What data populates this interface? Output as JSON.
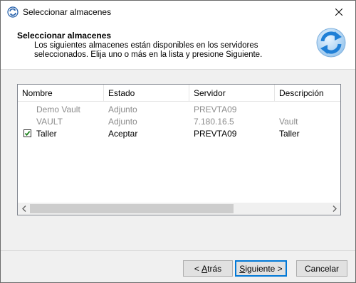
{
  "window": {
    "title": "Seleccionar almacenes",
    "title_icon": "sync-icon"
  },
  "header": {
    "title": "Seleccionar almacenes",
    "description": "Los siguientes almacenes están disponibles en los servidores seleccionados. Elija uno o más en la lista y presione Siguiente.",
    "icon": "sync-arrows-icon"
  },
  "list": {
    "columns": [
      "Nombre",
      "Estado",
      "Servidor",
      "Descripción"
    ],
    "rows": [
      {
        "name": "Demo Vault",
        "state": "Adjunto",
        "server": "PREVTA09",
        "description": "",
        "checked": false,
        "enabled": false
      },
      {
        "name": "VAULT",
        "state": "Adjunto",
        "server": "7.180.16.5",
        "description": "Vault",
        "checked": false,
        "enabled": false
      },
      {
        "name": "Taller",
        "state": "Aceptar",
        "server": "PREVTA09",
        "description": "Taller",
        "checked": true,
        "enabled": true
      }
    ]
  },
  "buttons": {
    "back_prefix": "< ",
    "back_access": "A",
    "back_rest": "trás",
    "next_access": "S",
    "next_rest": "iguiente >",
    "cancel": "Cancelar"
  },
  "colors": {
    "accent": "#0078d7",
    "disabled_text": "#8c8c8c",
    "check": "#1a7f1a"
  }
}
